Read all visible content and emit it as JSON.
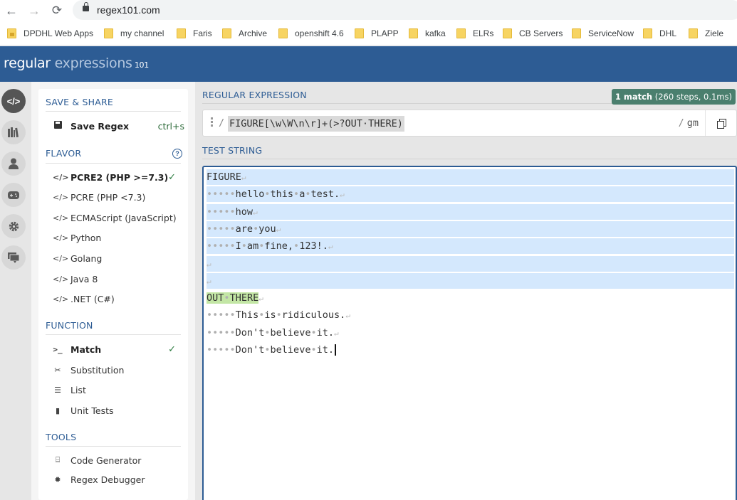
{
  "browser": {
    "url": "regex101.com",
    "nav": {
      "back": "←",
      "forward": "→",
      "reload": "⟳"
    },
    "bookmarks": [
      {
        "label": "DPDHL Web Apps",
        "icon": "apps-folder-icon"
      },
      {
        "label": "my channel",
        "icon": "folder-icon"
      },
      {
        "label": "Faris",
        "icon": "folder-icon"
      },
      {
        "label": "Archive",
        "icon": "folder-icon"
      },
      {
        "label": "openshift 4.6",
        "icon": "folder-icon"
      },
      {
        "label": "PLAPP",
        "icon": "folder-icon"
      },
      {
        "label": "kafka",
        "icon": "folder-icon"
      },
      {
        "label": "ELRs",
        "icon": "folder-icon"
      },
      {
        "label": "CB Servers",
        "icon": "folder-icon"
      },
      {
        "label": "ServiceNow",
        "icon": "folder-icon"
      },
      {
        "label": "DHL",
        "icon": "folder-icon"
      },
      {
        "label": "Ziele",
        "icon": "folder-icon"
      }
    ]
  },
  "header": {
    "logo_bold": "regular",
    "logo_light": " expressions",
    "logo_num": " 101"
  },
  "rail": [
    {
      "name": "editor",
      "glyph": "</>",
      "active": true
    },
    {
      "name": "library",
      "glyph": "▥",
      "active": false
    },
    {
      "name": "account",
      "glyph": "●",
      "active": false
    },
    {
      "name": "quiz",
      "glyph": "◼",
      "active": false
    },
    {
      "name": "settings",
      "glyph": "✱",
      "active": false
    },
    {
      "name": "chat",
      "glyph": "▬",
      "active": false
    }
  ],
  "sidebar": {
    "save_share": {
      "title": "SAVE & SHARE",
      "save_label": "Save Regex",
      "save_shortcut": "ctrl+s"
    },
    "flavor": {
      "title": "FLAVOR",
      "help": "?",
      "items": [
        {
          "label": "PCRE2 (PHP >=7.3)",
          "selected": true
        },
        {
          "label": "PCRE (PHP <7.3)",
          "selected": false
        },
        {
          "label": "ECMAScript (JavaScript)",
          "selected": false
        },
        {
          "label": "Python",
          "selected": false
        },
        {
          "label": "Golang",
          "selected": false
        },
        {
          "label": "Java 8",
          "selected": false
        },
        {
          "label": ".NET (C#)",
          "selected": false
        }
      ]
    },
    "function": {
      "title": "FUNCTION",
      "items": [
        {
          "label": "Match",
          "icon": "terminal-icon",
          "glyph": ">_",
          "selected": true
        },
        {
          "label": "Substitution",
          "icon": "scissors-icon",
          "glyph": "✂",
          "selected": false
        },
        {
          "label": "List",
          "icon": "list-settings-icon",
          "glyph": "☰",
          "selected": false
        },
        {
          "label": "Unit Tests",
          "icon": "test-tube-icon",
          "glyph": "▮",
          "selected": false
        }
      ]
    },
    "tools": {
      "title": "TOOLS",
      "items": [
        {
          "label": "Code Generator",
          "icon": "code-file-icon",
          "glyph": "⌸"
        },
        {
          "label": "Regex Debugger",
          "icon": "bug-icon",
          "glyph": "✹"
        }
      ]
    },
    "check_glyph": "✓"
  },
  "main": {
    "regex_title": "REGULAR EXPRESSION",
    "match_info_count": "1 match",
    "match_info_detail": " (260 steps, 0.1ms)",
    "delimiter": "/",
    "regex": "FIGURE[\\w\\W\\n\\r]+(>?OUT·THERE)",
    "flags": "gm",
    "test_title": "TEST STRING",
    "test_lines": [
      {
        "text": "FIGURE",
        "indent": 0,
        "highlight": true,
        "newline": true
      },
      {
        "text": "hello·this·a·test.",
        "indent": 5,
        "highlight": true,
        "newline": true
      },
      {
        "text": "how",
        "indent": 5,
        "highlight": true,
        "newline": true
      },
      {
        "text": "are·you",
        "indent": 5,
        "highlight": true,
        "newline": true
      },
      {
        "text": "I·am·fine,·123!.",
        "indent": 5,
        "highlight": true,
        "newline": true
      },
      {
        "text": "",
        "indent": 0,
        "highlight": true,
        "newline": true
      },
      {
        "text": "",
        "indent": 0,
        "highlight": true,
        "newline": true
      },
      {
        "text": "OUT·THERE",
        "indent": 0,
        "highlight": false,
        "group": true,
        "newline": true
      },
      {
        "text": "This·is·ridiculous.",
        "indent": 5,
        "highlight": false,
        "newline": true
      },
      {
        "text": "Don't·believe·it.",
        "indent": 5,
        "highlight": false,
        "newline": true
      },
      {
        "text": "Don't·believe·it.",
        "indent": 5,
        "highlight": false,
        "newline": false,
        "caret": true
      }
    ],
    "colors": {
      "brand": "#2d5c94",
      "match_bg": "#d4e8fd",
      "group_bg": "#c3e6a5",
      "badge_bg": "#4a7f6e"
    }
  }
}
